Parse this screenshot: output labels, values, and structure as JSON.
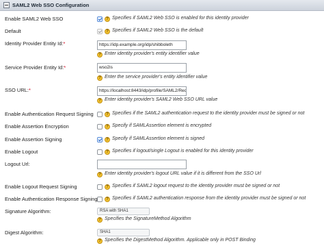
{
  "section": {
    "title": "SAML2 Web SSO Configuration"
  },
  "fields": {
    "enable_saml2": {
      "label": "Enable SAML2 Web SSO",
      "help": "Specifies if SAML2 Web SSO is enabled for this identity provider",
      "checked": true
    },
    "default": {
      "label": "Default",
      "help": "Specifies if SAML2 Web SSO is the default",
      "checked": true,
      "disabled": true
    },
    "idp_entity_id": {
      "label": "Identity Provider Entity Id:",
      "required": "*",
      "value": "https://idp.example.org/idp/shibboleth",
      "help": "Enter identity provider's entity identifier value"
    },
    "sp_entity_id": {
      "label": "Service Provider Entity Id:",
      "required": "*",
      "value": "wso2is",
      "help": "Enter the service provider's entity identifier value"
    },
    "sso_url": {
      "label": "SSO URL:",
      "required": "*",
      "value": "https://localhost:8443/idp/profile/SAML2/Redi",
      "help": "Enter identity provider's SAML2 Web SSO URL value"
    },
    "auth_request_signing": {
      "label": "Enable Authentication Request Signing",
      "help": "Specifies if the SAML2 authentication request to the identity provider must be signed or not",
      "checked": false
    },
    "assertion_encryption": {
      "label": "Enable Assertion Encryption",
      "help": "Specify if SAMLAssertion element is encrypted",
      "checked": false
    },
    "assertion_signing": {
      "label": "Enable Assertion Signing",
      "help": "Specify if SAMLAssertion element is signed",
      "checked": true
    },
    "logout": {
      "label": "Enable Logout",
      "help": "Specifies if logout/single Logout is enabled for this identity provider",
      "checked": false
    },
    "logout_url": {
      "label": "Logout Url:",
      "value": "",
      "help": "Enter identity provider's logout URL value if it is different from the SSO Url"
    },
    "logout_request_signing": {
      "label": "Enable Logout Request Signing",
      "help": "Specifies if SAML2 logout request to the identity provider must be signed or not",
      "checked": false
    },
    "auth_response_signing": {
      "label": "Enable Authentication Response Signing",
      "help": "Specifies if SAML2 authentication response from the identity provider must be signed or not",
      "checked": false
    },
    "signature_algorithm": {
      "label": "Signature Algorithm:",
      "value": "RSA with SHA1",
      "help": "Specifies the SignatureMethod Algorithm"
    },
    "digest_algorithm": {
      "label": "Digest Algorithm:",
      "value": "SHA1",
      "help": "Specifies the DigestMethod Algorithm. Applicable only in POST Binding"
    }
  },
  "help_glyph": "?"
}
